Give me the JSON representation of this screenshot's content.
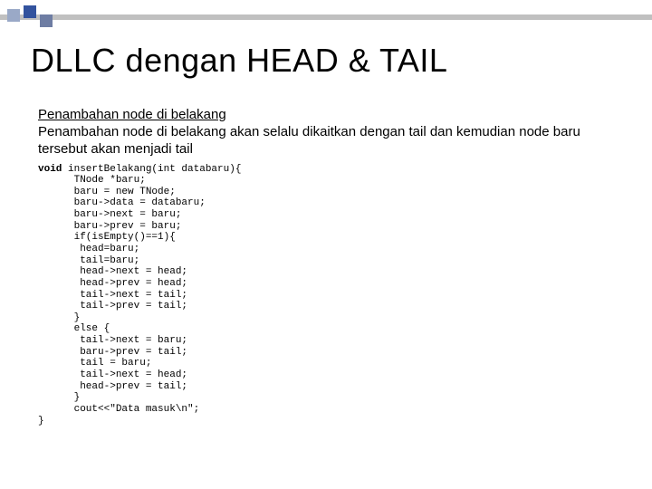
{
  "title": "DLLC dengan HEAD & TAIL",
  "subheading": "Penambahan node di belakang",
  "paragraph": "Penambahan node di belakang akan selalu dikaitkan dengan tail dan kemudian node baru tersebut akan menjadi tail",
  "code": {
    "kw_void": "void",
    "sig": " insertBelakang(int databaru){",
    "lines": "      TNode *baru;\n      baru = new TNode;\n      baru->data = databaru;\n      baru->next = baru;\n      baru->prev = baru;\n      if(isEmpty()==1){\n       head=baru;\n       tail=baru;\n       head->next = head;\n       head->prev = head;\n       tail->next = tail;\n       tail->prev = tail;\n      }\n      else {\n       tail->next = baru;\n       baru->prev = tail;\n       tail = baru;\n       tail->next = head;\n       head->prev = tail;\n      }\n      cout<<\"Data masuk\\n\";\n}"
  }
}
